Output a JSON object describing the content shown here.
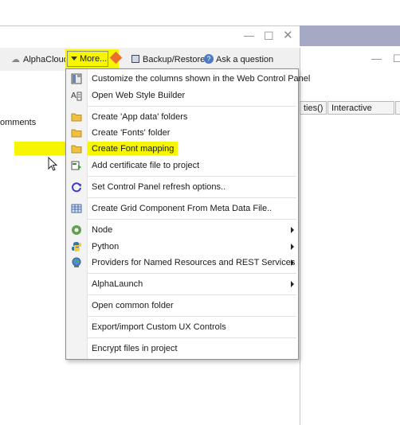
{
  "toolbar": {
    "alphacloud_label": "AlphaCloud",
    "more_label": "More...",
    "backup_label": "Backup/Restore",
    "ask_label": "Ask a question"
  },
  "right_pane": {
    "tab_properties_label": "ties()",
    "tab_interactive_label": "Interactive"
  },
  "left_pane": {
    "label": "omments"
  },
  "menu": {
    "items": [
      {
        "label": "Customize the columns shown in the Web Control Panel",
        "icon": "columns-icon"
      },
      {
        "label": "Open Web Style Builder",
        "icon": "style-builder-icon"
      },
      {
        "label": "Create 'App data' folders",
        "icon": "folder-icon"
      },
      {
        "label": "Create 'Fonts' folder",
        "icon": "folder-icon"
      },
      {
        "label": "Create Font mapping",
        "icon": "folder-icon"
      },
      {
        "label": "Add certificate file to project",
        "icon": "certificate-icon"
      },
      {
        "label": "Set Control Panel refresh options..",
        "icon": "refresh-icon"
      },
      {
        "label": "Create Grid Component From Meta Data File..",
        "icon": "grid-icon"
      },
      {
        "label": "Node",
        "icon": "node-icon",
        "submenu": true
      },
      {
        "label": "Python",
        "icon": "python-icon",
        "submenu": true
      },
      {
        "label": "Providers for Named Resources and REST Services",
        "icon": "globe-icon",
        "submenu": true
      },
      {
        "label": "AlphaLaunch",
        "icon": "",
        "submenu": true
      },
      {
        "label": "Open common folder",
        "icon": ""
      },
      {
        "label": "Export/import Custom UX Controls",
        "icon": ""
      },
      {
        "label": "Encrypt files in project",
        "icon": ""
      }
    ]
  },
  "colors": {
    "highlight_yellow": "#f6f600",
    "titlebar_strip": "#a6a9c4",
    "folder": "#f0c040"
  }
}
